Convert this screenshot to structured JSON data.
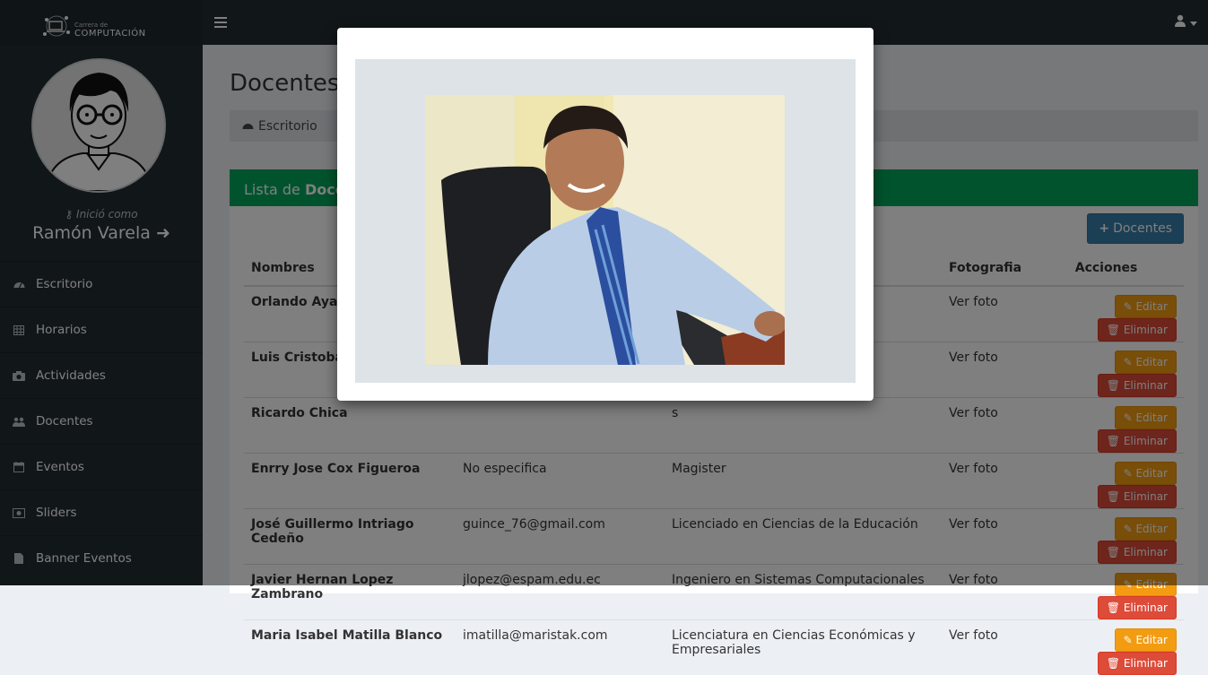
{
  "brand": {
    "small": "Carrera de",
    "big": "COMPUTACIÓN"
  },
  "sidebar": {
    "login_label": "Inició como",
    "username": "Ramón Varela",
    "items": [
      {
        "label": "Escritorio",
        "icon": "dashboard-icon"
      },
      {
        "label": "Horarios",
        "icon": "table-icon"
      },
      {
        "label": "Actividades",
        "icon": "camera-icon"
      },
      {
        "label": "Docentes",
        "icon": "users-icon"
      },
      {
        "label": "Eventos",
        "icon": "calendar-icon"
      },
      {
        "label": "Sliders",
        "icon": "image-icon"
      },
      {
        "label": "Banner Eventos",
        "icon": "file-icon"
      }
    ]
  },
  "page": {
    "title": "Docentes",
    "breadcrumb": "Escritorio",
    "box_title_prefix": "Lista de ",
    "box_title_bold": "Docentes",
    "add_button": "Docentes"
  },
  "table": {
    "headers": [
      "Nombres",
      "",
      "",
      "Fotografia",
      "Acciones"
    ],
    "view_photo": "Ver foto",
    "edit_label": "Editar",
    "delete_label": "Eliminar",
    "rows": [
      {
        "name": "Orlando Ayala",
        "email": "",
        "title": ""
      },
      {
        "name": "Luis Cristobal",
        "email": "",
        "title": ""
      },
      {
        "name": "Ricardo Chica",
        "email": "",
        "title": "s"
      },
      {
        "name": "Enrry Jose Cox Figueroa",
        "email": "No especifica",
        "title": "Magister"
      },
      {
        "name": "José Guillermo Intriago Cedeño",
        "email": "guince_76@gmail.com",
        "title": "Licenciado en Ciencias de la Educación"
      },
      {
        "name": "Javier Hernan Lopez Zambrano",
        "email": "jlopez@espam.edu.ec",
        "title": "Ingeniero en Sistemas Computacionales"
      },
      {
        "name": "Maria Isabel Matilla Blanco",
        "email": "imatilla@maristak.com",
        "title": "Licenciatura en Ciencias Económicas y Empresariales"
      }
    ]
  },
  "colors": {
    "topbar": "#222d32",
    "accent_green": "#00a65a",
    "primary": "#367fa9",
    "warning": "#f39c12",
    "danger": "#dd4b39"
  }
}
